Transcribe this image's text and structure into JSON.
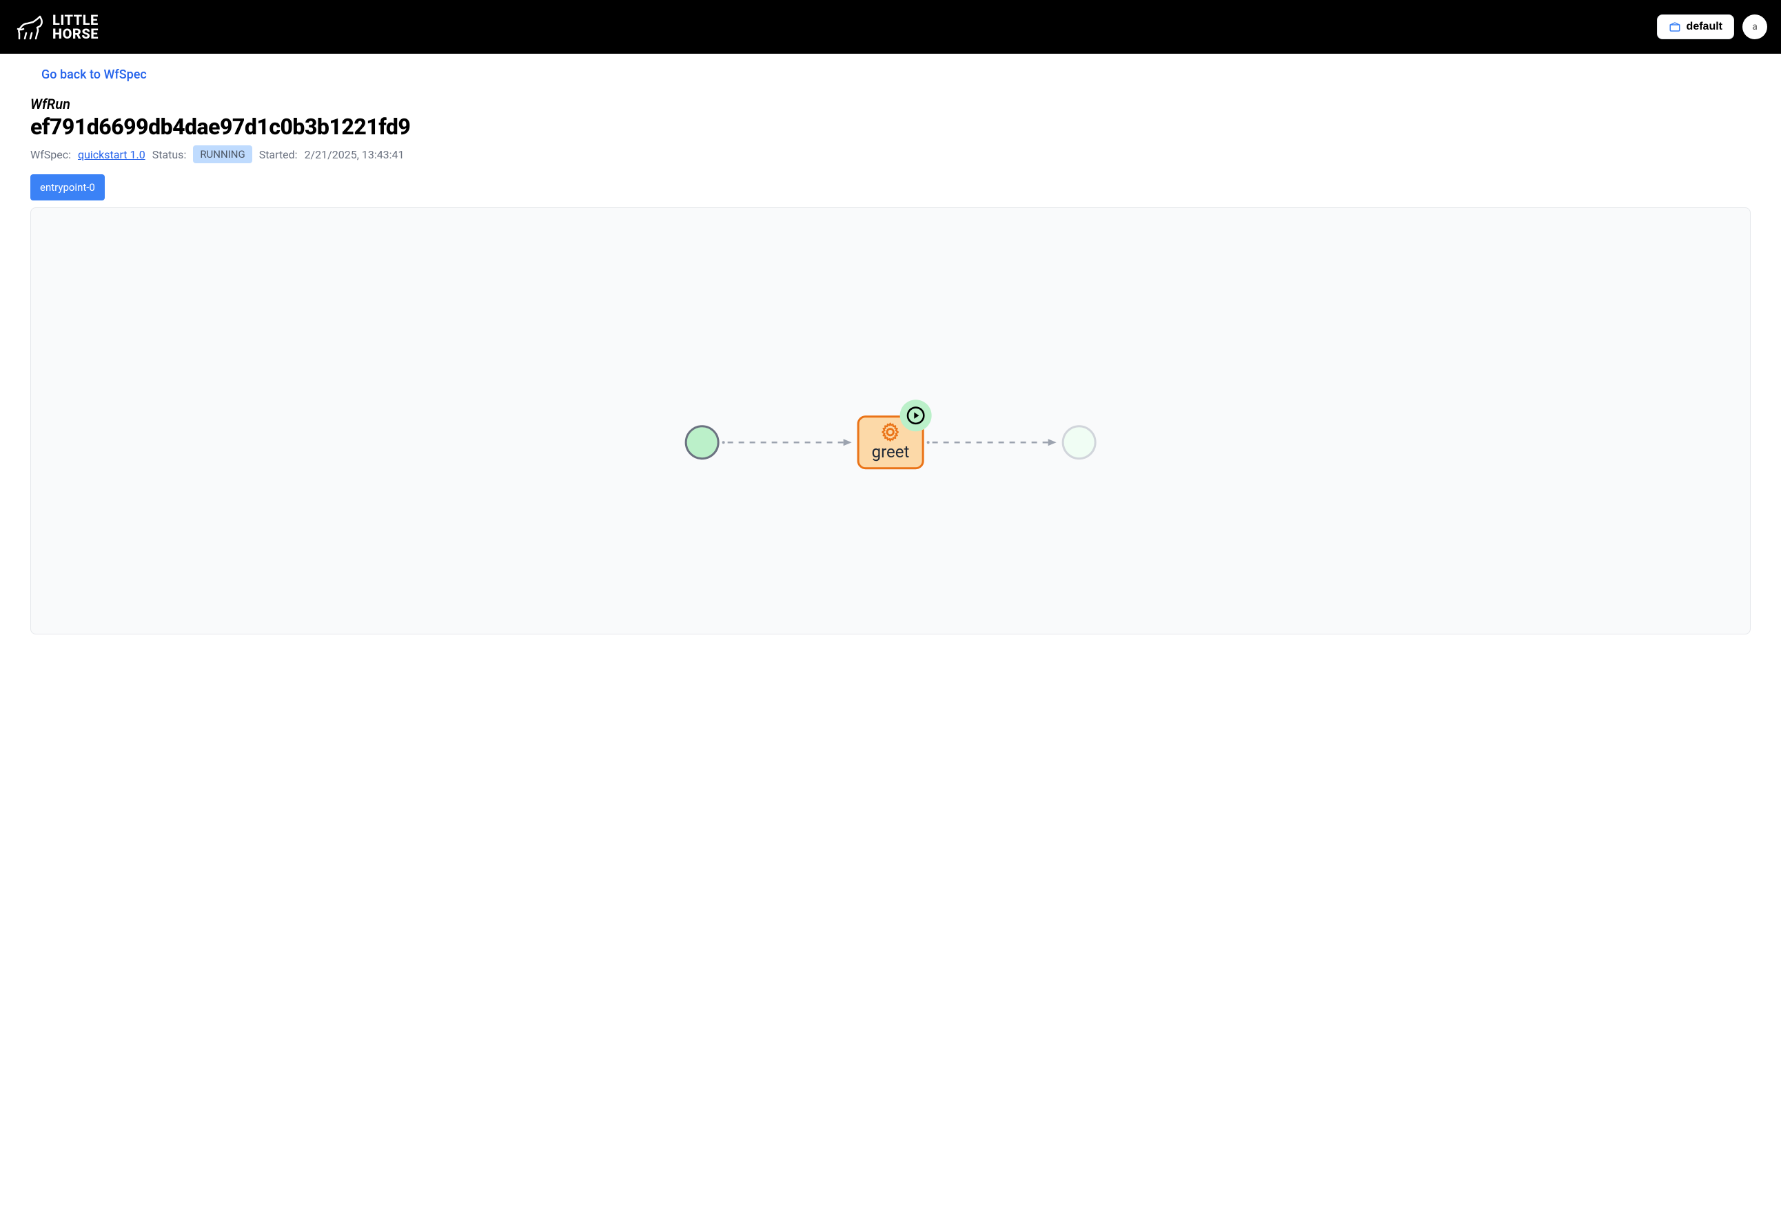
{
  "header": {
    "logo": {
      "line1": "LITTLE",
      "line2": "HORSE"
    },
    "tenant_label": "default",
    "avatar_char": "a"
  },
  "page": {
    "back_link": "Go back to WfSpec",
    "subtitle": "WfRun",
    "title": "ef791d6699db4dae97d1c0b3b1221fd9",
    "wfspec_label": "WfSpec:",
    "wfspec_link": "quickstart 1.0",
    "status_label": "Status:",
    "status_value": "RUNNING",
    "started_label": "Started:",
    "started_value": "2/21/2025, 13:43:41",
    "tab": "entrypoint-0"
  },
  "diagram": {
    "task_name": "greet"
  }
}
